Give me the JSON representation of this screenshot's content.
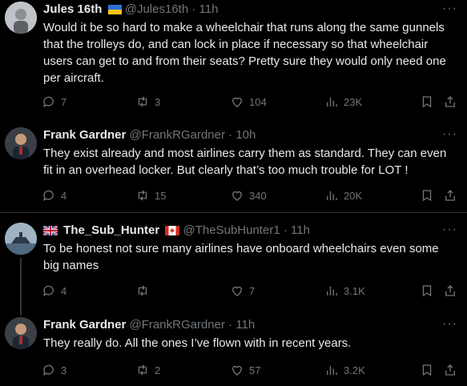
{
  "tweets": [
    {
      "name": "Jules 16th",
      "handle": "@Jules16th",
      "time": "11h",
      "text": "Would it be so hard to make a wheelchair that runs along the same gunnels that the trolleys do, and can lock in place if necessary so that wheelchair users can get to and from their seats? Pretty sure they would only need one per aircraft.",
      "replies": "7",
      "retweets": "3",
      "likes": "104",
      "views": "23K"
    },
    {
      "name": "Frank Gardner",
      "handle": "@FrankRGardner",
      "time": "10h",
      "text": "They exist already and most airlines carry them as standard. They can even fit in an overhead locker. But clearly that’s too much trouble for LOT !",
      "replies": "4",
      "retweets": "15",
      "likes": "340",
      "views": "20K"
    },
    {
      "name": "The_Sub_Hunter",
      "handle": "@TheSubHunter1",
      "time": "11h",
      "text": "To be honest not sure many airlines have onboard wheelchairs even some big names",
      "replies": "4",
      "retweets": "",
      "likes": "7",
      "views": "3.1K"
    },
    {
      "name": "Frank Gardner",
      "handle": "@FrankRGardner",
      "time": "11h",
      "text": "They really do. All the ones I’ve flown with in recent years.",
      "replies": "3",
      "retweets": "2",
      "likes": "57",
      "views": "3.2K"
    }
  ],
  "sep": "·",
  "more": "···",
  "colors": {
    "background": "#000000",
    "text": "#e7e9ea",
    "muted": "#71767b",
    "divider": "#2f3336"
  },
  "icons": [
    "reply-icon",
    "retweet-icon",
    "like-icon",
    "views-icon",
    "bookmark-icon",
    "share-icon",
    "ukraine-flag-icon",
    "uk-flag-icon",
    "canada-flag-icon"
  ]
}
